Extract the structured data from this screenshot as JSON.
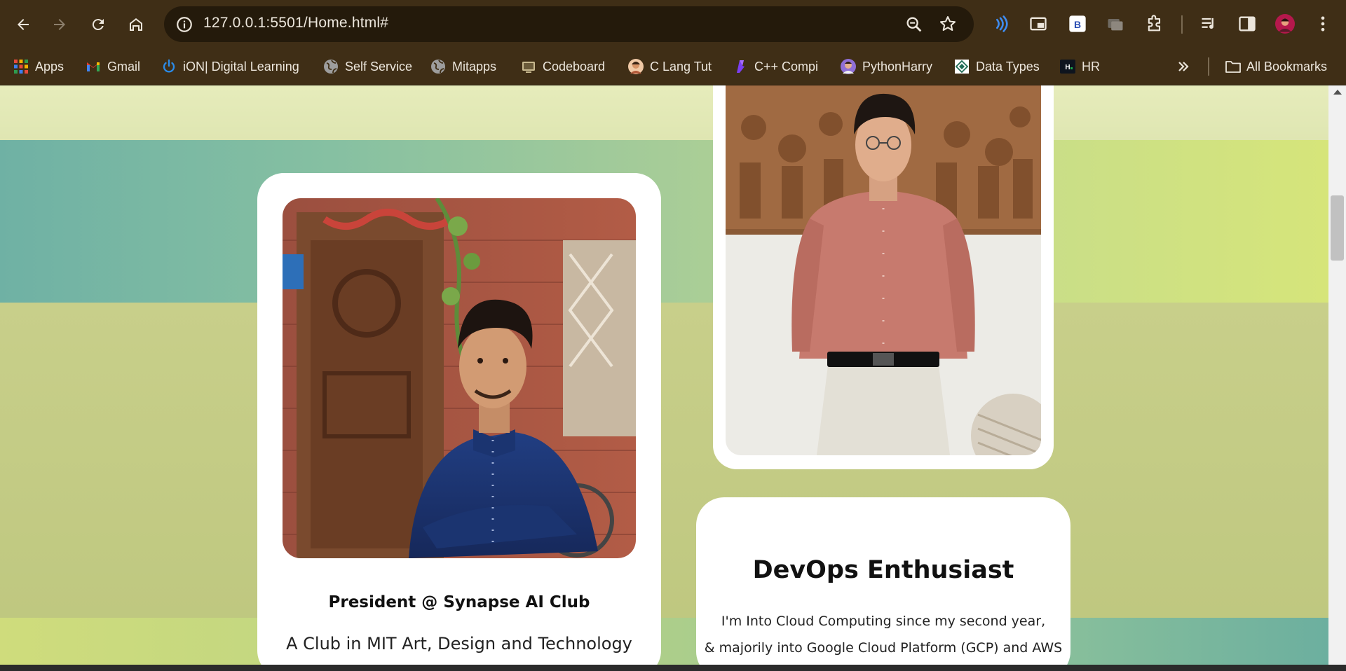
{
  "browser": {
    "url": "127.0.0.1:5501/Home.html#",
    "bookmarks": [
      {
        "label": "Apps",
        "icon": "apps-grid-icon"
      },
      {
        "label": "Gmail",
        "icon": "gmail-icon"
      },
      {
        "label": "iON| Digital Learning",
        "icon": "ion-power-icon"
      },
      {
        "label": "Self Service",
        "icon": "globe-icon"
      },
      {
        "label": "Mitapps",
        "icon": "globe-icon"
      },
      {
        "label": "Codeboard",
        "icon": "codeboard-icon"
      },
      {
        "label": "C Lang Tut",
        "icon": "avatar-icon"
      },
      {
        "label": "C++ Compi",
        "icon": "compiler-icon"
      },
      {
        "label": "PythonHarry",
        "icon": "avatar-icon"
      },
      {
        "label": "Data Types",
        "icon": "datatypes-icon"
      },
      {
        "label": "HR",
        "icon": "hackerrank-icon"
      }
    ],
    "all_bookmarks": "All Bookmarks",
    "colors": {
      "chrome": "#3f2e16",
      "omnibox": "#241a0b"
    }
  },
  "page": {
    "left_card": {
      "role": "President @ Synapse AI Club",
      "description": "A Club in MIT Art, Design and Technology"
    },
    "right_card": {
      "heading": "DevOps Enthusiast",
      "lines": [
        "I'm Into Cloud Computing since my second year,",
        "& majorily into Google Cloud Platform (GCP) and AWS"
      ]
    }
  }
}
